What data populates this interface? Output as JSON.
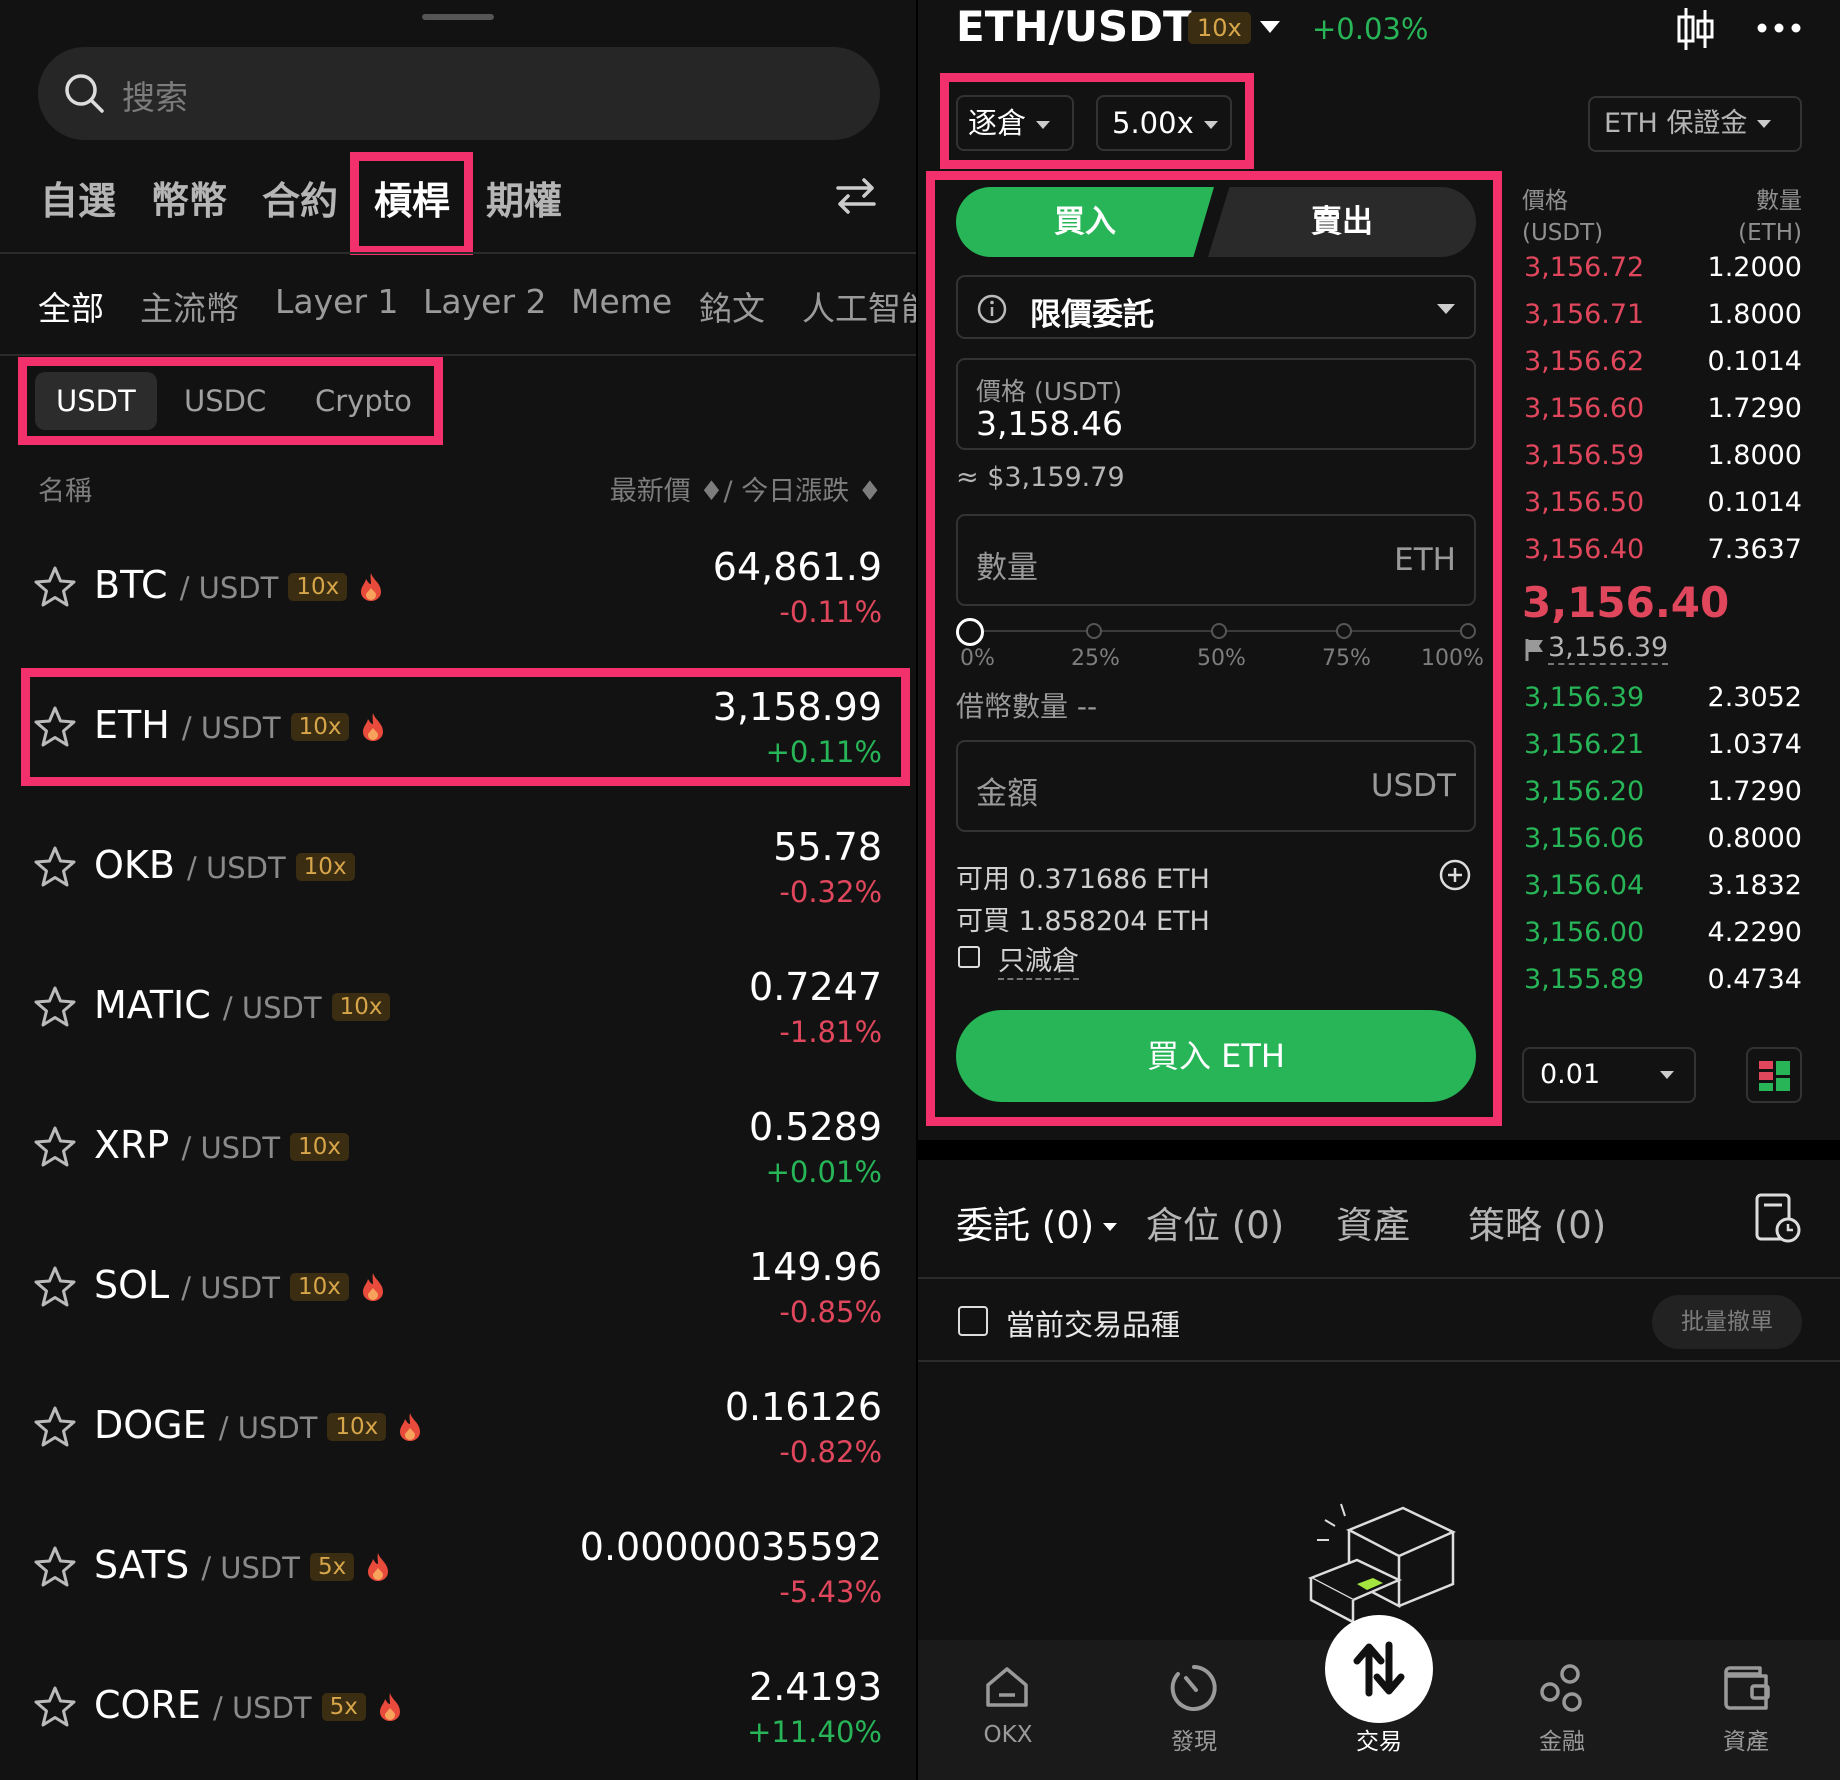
{
  "left": {
    "search_placeholder": "搜索",
    "main_tabs": [
      "自選",
      "幣幣",
      "合約",
      "槓桿",
      "期權"
    ],
    "active_main_tab": "槓桿",
    "sub_tabs": [
      "全部",
      "主流幣",
      "Layer 1",
      "Layer 2",
      "Meme",
      "銘文",
      "人工智能"
    ],
    "quote_tabs": [
      "USDT",
      "USDC",
      "Crypto"
    ],
    "header_name": "名稱",
    "header_sort": "最新價 ♦/ 今日漲跌 ♦",
    "rows": [
      {
        "base": "BTC",
        "quote": "/ USDT",
        "lev": "10x",
        "hot": true,
        "price": "64,861.9",
        "change": "-0.11%",
        "dir": "down"
      },
      {
        "base": "ETH",
        "quote": "/ USDT",
        "lev": "10x",
        "hot": true,
        "price": "3,158.99",
        "change": "+0.11%",
        "dir": "up"
      },
      {
        "base": "OKB",
        "quote": "/ USDT",
        "lev": "10x",
        "hot": false,
        "price": "55.78",
        "change": "-0.32%",
        "dir": "down"
      },
      {
        "base": "MATIC",
        "quote": "/ USDT",
        "lev": "10x",
        "hot": false,
        "price": "0.7247",
        "change": "-1.81%",
        "dir": "down"
      },
      {
        "base": "XRP",
        "quote": "/ USDT",
        "lev": "10x",
        "hot": false,
        "price": "0.5289",
        "change": "+0.01%",
        "dir": "up"
      },
      {
        "base": "SOL",
        "quote": "/ USDT",
        "lev": "10x",
        "hot": true,
        "price": "149.96",
        "change": "-0.85%",
        "dir": "down"
      },
      {
        "base": "DOGE",
        "quote": "/ USDT",
        "lev": "10x",
        "hot": true,
        "price": "0.16126",
        "change": "-0.82%",
        "dir": "down"
      },
      {
        "base": "SATS",
        "quote": "/ USDT",
        "lev": "5x",
        "hot": true,
        "price": "0.00000035592",
        "change": "-5.43%",
        "dir": "down"
      },
      {
        "base": "CORE",
        "quote": "/ USDT",
        "lev": "5x",
        "hot": true,
        "price": "2.4193",
        "change": "+11.40%",
        "dir": "up"
      }
    ]
  },
  "right": {
    "pair": "ETH/USDT",
    "pair_lev": "10x",
    "pair_change": "+0.03%",
    "margin_mode": "逐倉",
    "leverage": "5.00x",
    "margin_asset": "ETH 保證金",
    "buy_label": "買入",
    "sell_label": "賣出",
    "order_type": "限價委託",
    "price_label": "價格 (USDT)",
    "price_value": "3,158.46",
    "price_approx": "≈ $3,159.79",
    "qty_label": "數量",
    "qty_unit": "ETH",
    "slider_marks": [
      "0%",
      "25%",
      "50%",
      "75%",
      "100%"
    ],
    "slider_value": 0,
    "borrow_label": "借幣數量 --",
    "amount_label": "金額",
    "amount_unit": "USDT",
    "available": "可用 0.371686 ETH",
    "can_buy": "可買 1.858204 ETH",
    "reduce_only": "只減倉",
    "submit_label": "買入 ETH",
    "ob_header_price": [
      "價格",
      "(USDT)"
    ],
    "ob_header_qty": [
      "數量",
      "(ETH)"
    ],
    "asks": [
      {
        "p": "3,156.72",
        "q": "1.2000"
      },
      {
        "p": "3,156.71",
        "q": "1.8000"
      },
      {
        "p": "3,156.62",
        "q": "0.1014"
      },
      {
        "p": "3,156.60",
        "q": "1.7290"
      },
      {
        "p": "3,156.59",
        "q": "1.8000"
      },
      {
        "p": "3,156.50",
        "q": "0.1014"
      },
      {
        "p": "3,156.40",
        "q": "7.3637"
      }
    ],
    "last_price": "3,156.40",
    "mark_price": "3,156.39",
    "bids": [
      {
        "p": "3,156.39",
        "q": "2.3052"
      },
      {
        "p": "3,156.21",
        "q": "1.0374"
      },
      {
        "p": "3,156.20",
        "q": "1.7290"
      },
      {
        "p": "3,156.06",
        "q": "0.8000"
      },
      {
        "p": "3,156.04",
        "q": "3.1832"
      },
      {
        "p": "3,156.00",
        "q": "4.2290"
      },
      {
        "p": "3,155.89",
        "q": "0.4734"
      }
    ],
    "depth_step": "0.01",
    "bottom_tabs": [
      "委託 (0)",
      "倉位 (0)",
      "資產",
      "策略 (0)"
    ],
    "current_pair_only": "當前交易品種",
    "batch_cancel": "批量撤單",
    "nav": [
      "OKX",
      "發現",
      "交易",
      "金融",
      "資產"
    ]
  },
  "colors": {
    "up": "#27b557",
    "down": "#e0475c",
    "highlight": "#f2306b",
    "leverage_badge": "#d7a54a"
  }
}
